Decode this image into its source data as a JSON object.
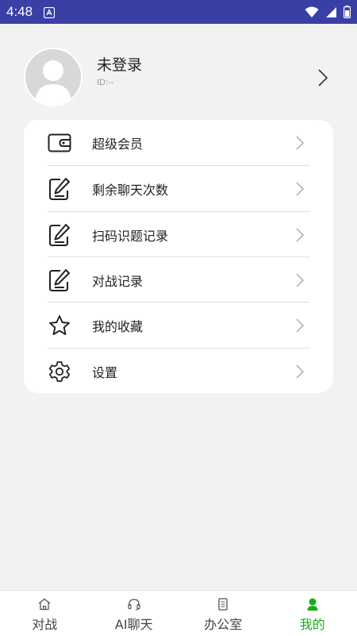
{
  "status_bar": {
    "time": "4:48"
  },
  "profile": {
    "name": "未登录",
    "id_text": "ID:--"
  },
  "menu": [
    {
      "label": "超级会员",
      "icon": "wallet-icon"
    },
    {
      "label": "剩余聊天次数",
      "icon": "edit-icon"
    },
    {
      "label": "扫码识题记录",
      "icon": "edit-icon"
    },
    {
      "label": "对战记录",
      "icon": "edit-icon"
    },
    {
      "label": "我的收藏",
      "icon": "star-icon"
    },
    {
      "label": "设置",
      "icon": "gear-icon"
    }
  ],
  "tabs": [
    {
      "label": "对战",
      "icon": "home-icon"
    },
    {
      "label": "AI聊天",
      "icon": "headset-icon"
    },
    {
      "label": "办公室",
      "icon": "document-icon"
    },
    {
      "label": "我的",
      "icon": "person-icon",
      "active": true
    }
  ],
  "colors": {
    "status_bar": "#3a3fa6",
    "active_tab": "#1aad19",
    "background": "#f2f2f2"
  }
}
